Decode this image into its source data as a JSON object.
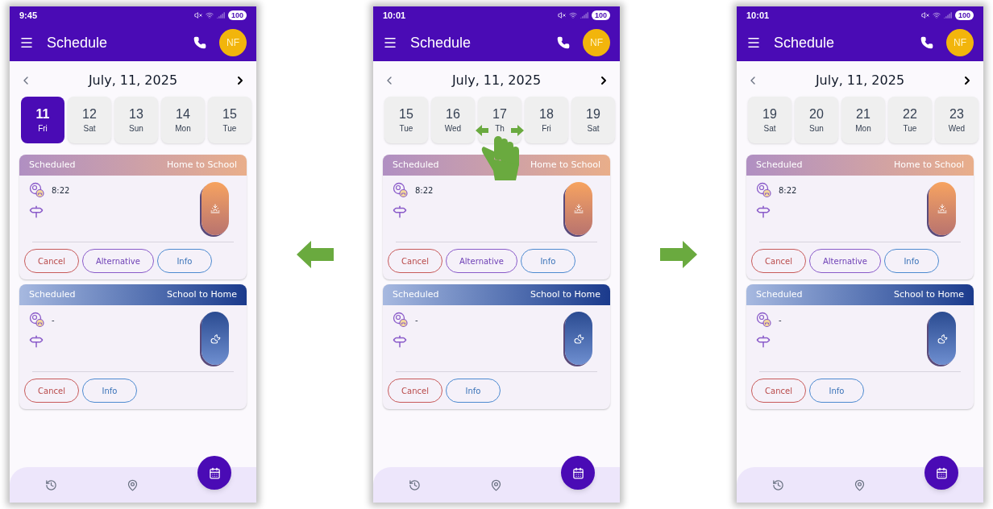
{
  "phones": [
    {
      "status_time": "9:45",
      "battery": "100",
      "title": "Schedule",
      "avatar": "NF",
      "date": "July, 11, 2025",
      "gesture": false,
      "days": [
        {
          "num": "11",
          "day": "Fri",
          "selected": true
        },
        {
          "num": "12",
          "day": "Sat",
          "selected": false
        },
        {
          "num": "13",
          "day": "Sun",
          "selected": false
        },
        {
          "num": "14",
          "day": "Mon",
          "selected": false
        },
        {
          "num": "15",
          "day": "Tue",
          "selected": false
        }
      ],
      "trips": [
        {
          "status": "Scheduled",
          "route": "Home to School",
          "kind": "day",
          "time": "8:22",
          "buttons": [
            {
              "label": "Cancel",
              "kind": "cancel"
            },
            {
              "label": "Alternative",
              "kind": "alternative"
            },
            {
              "label": "Info",
              "kind": "info"
            }
          ]
        },
        {
          "status": "Scheduled",
          "route": "School to Home",
          "kind": "night",
          "time": "-",
          "buttons": [
            {
              "label": "Cancel",
              "kind": "cancel"
            },
            {
              "label": "Info",
              "kind": "info"
            }
          ]
        }
      ]
    },
    {
      "status_time": "10:01",
      "battery": "100",
      "title": "Schedule",
      "avatar": "NF",
      "date": "July, 11, 2025",
      "gesture": true,
      "days": [
        {
          "num": "15",
          "day": "Tue",
          "selected": false
        },
        {
          "num": "16",
          "day": "Wed",
          "selected": false
        },
        {
          "num": "17",
          "day": "Th",
          "selected": false
        },
        {
          "num": "18",
          "day": "Fri",
          "selected": false
        },
        {
          "num": "19",
          "day": "Sat",
          "selected": false
        }
      ],
      "trips": [
        {
          "status": "Scheduled",
          "route": "Home to School",
          "kind": "day",
          "time": "8:22",
          "buttons": [
            {
              "label": "Cancel",
              "kind": "cancel"
            },
            {
              "label": "Alternative",
              "kind": "alternative"
            },
            {
              "label": "Info",
              "kind": "info"
            }
          ]
        },
        {
          "status": "Scheduled",
          "route": "School to Home",
          "kind": "night",
          "time": "-",
          "buttons": [
            {
              "label": "Cancel",
              "kind": "cancel"
            },
            {
              "label": "Info",
              "kind": "info"
            }
          ]
        }
      ]
    },
    {
      "status_time": "10:01",
      "battery": "100",
      "title": "Schedule",
      "avatar": "NF",
      "date": "July, 11, 2025",
      "gesture": false,
      "days": [
        {
          "num": "19",
          "day": "Sat",
          "selected": false
        },
        {
          "num": "20",
          "day": "Sun",
          "selected": false
        },
        {
          "num": "21",
          "day": "Mon",
          "selected": false
        },
        {
          "num": "22",
          "day": "Tue",
          "selected": false
        },
        {
          "num": "23",
          "day": "Wed",
          "selected": false
        }
      ],
      "trips": [
        {
          "status": "Scheduled",
          "route": "Home to School",
          "kind": "day",
          "time": "8:22",
          "buttons": [
            {
              "label": "Cancel",
              "kind": "cancel"
            },
            {
              "label": "Alternative",
              "kind": "alternative"
            },
            {
              "label": "Info",
              "kind": "info"
            }
          ]
        },
        {
          "status": "Scheduled",
          "route": "School to Home",
          "kind": "night",
          "time": "-",
          "buttons": [
            {
              "label": "Cancel",
              "kind": "cancel"
            },
            {
              "label": "Info",
              "kind": "info"
            }
          ]
        }
      ]
    }
  ],
  "arrows": [
    {
      "kind": "left"
    },
    {
      "kind": "right"
    }
  ]
}
